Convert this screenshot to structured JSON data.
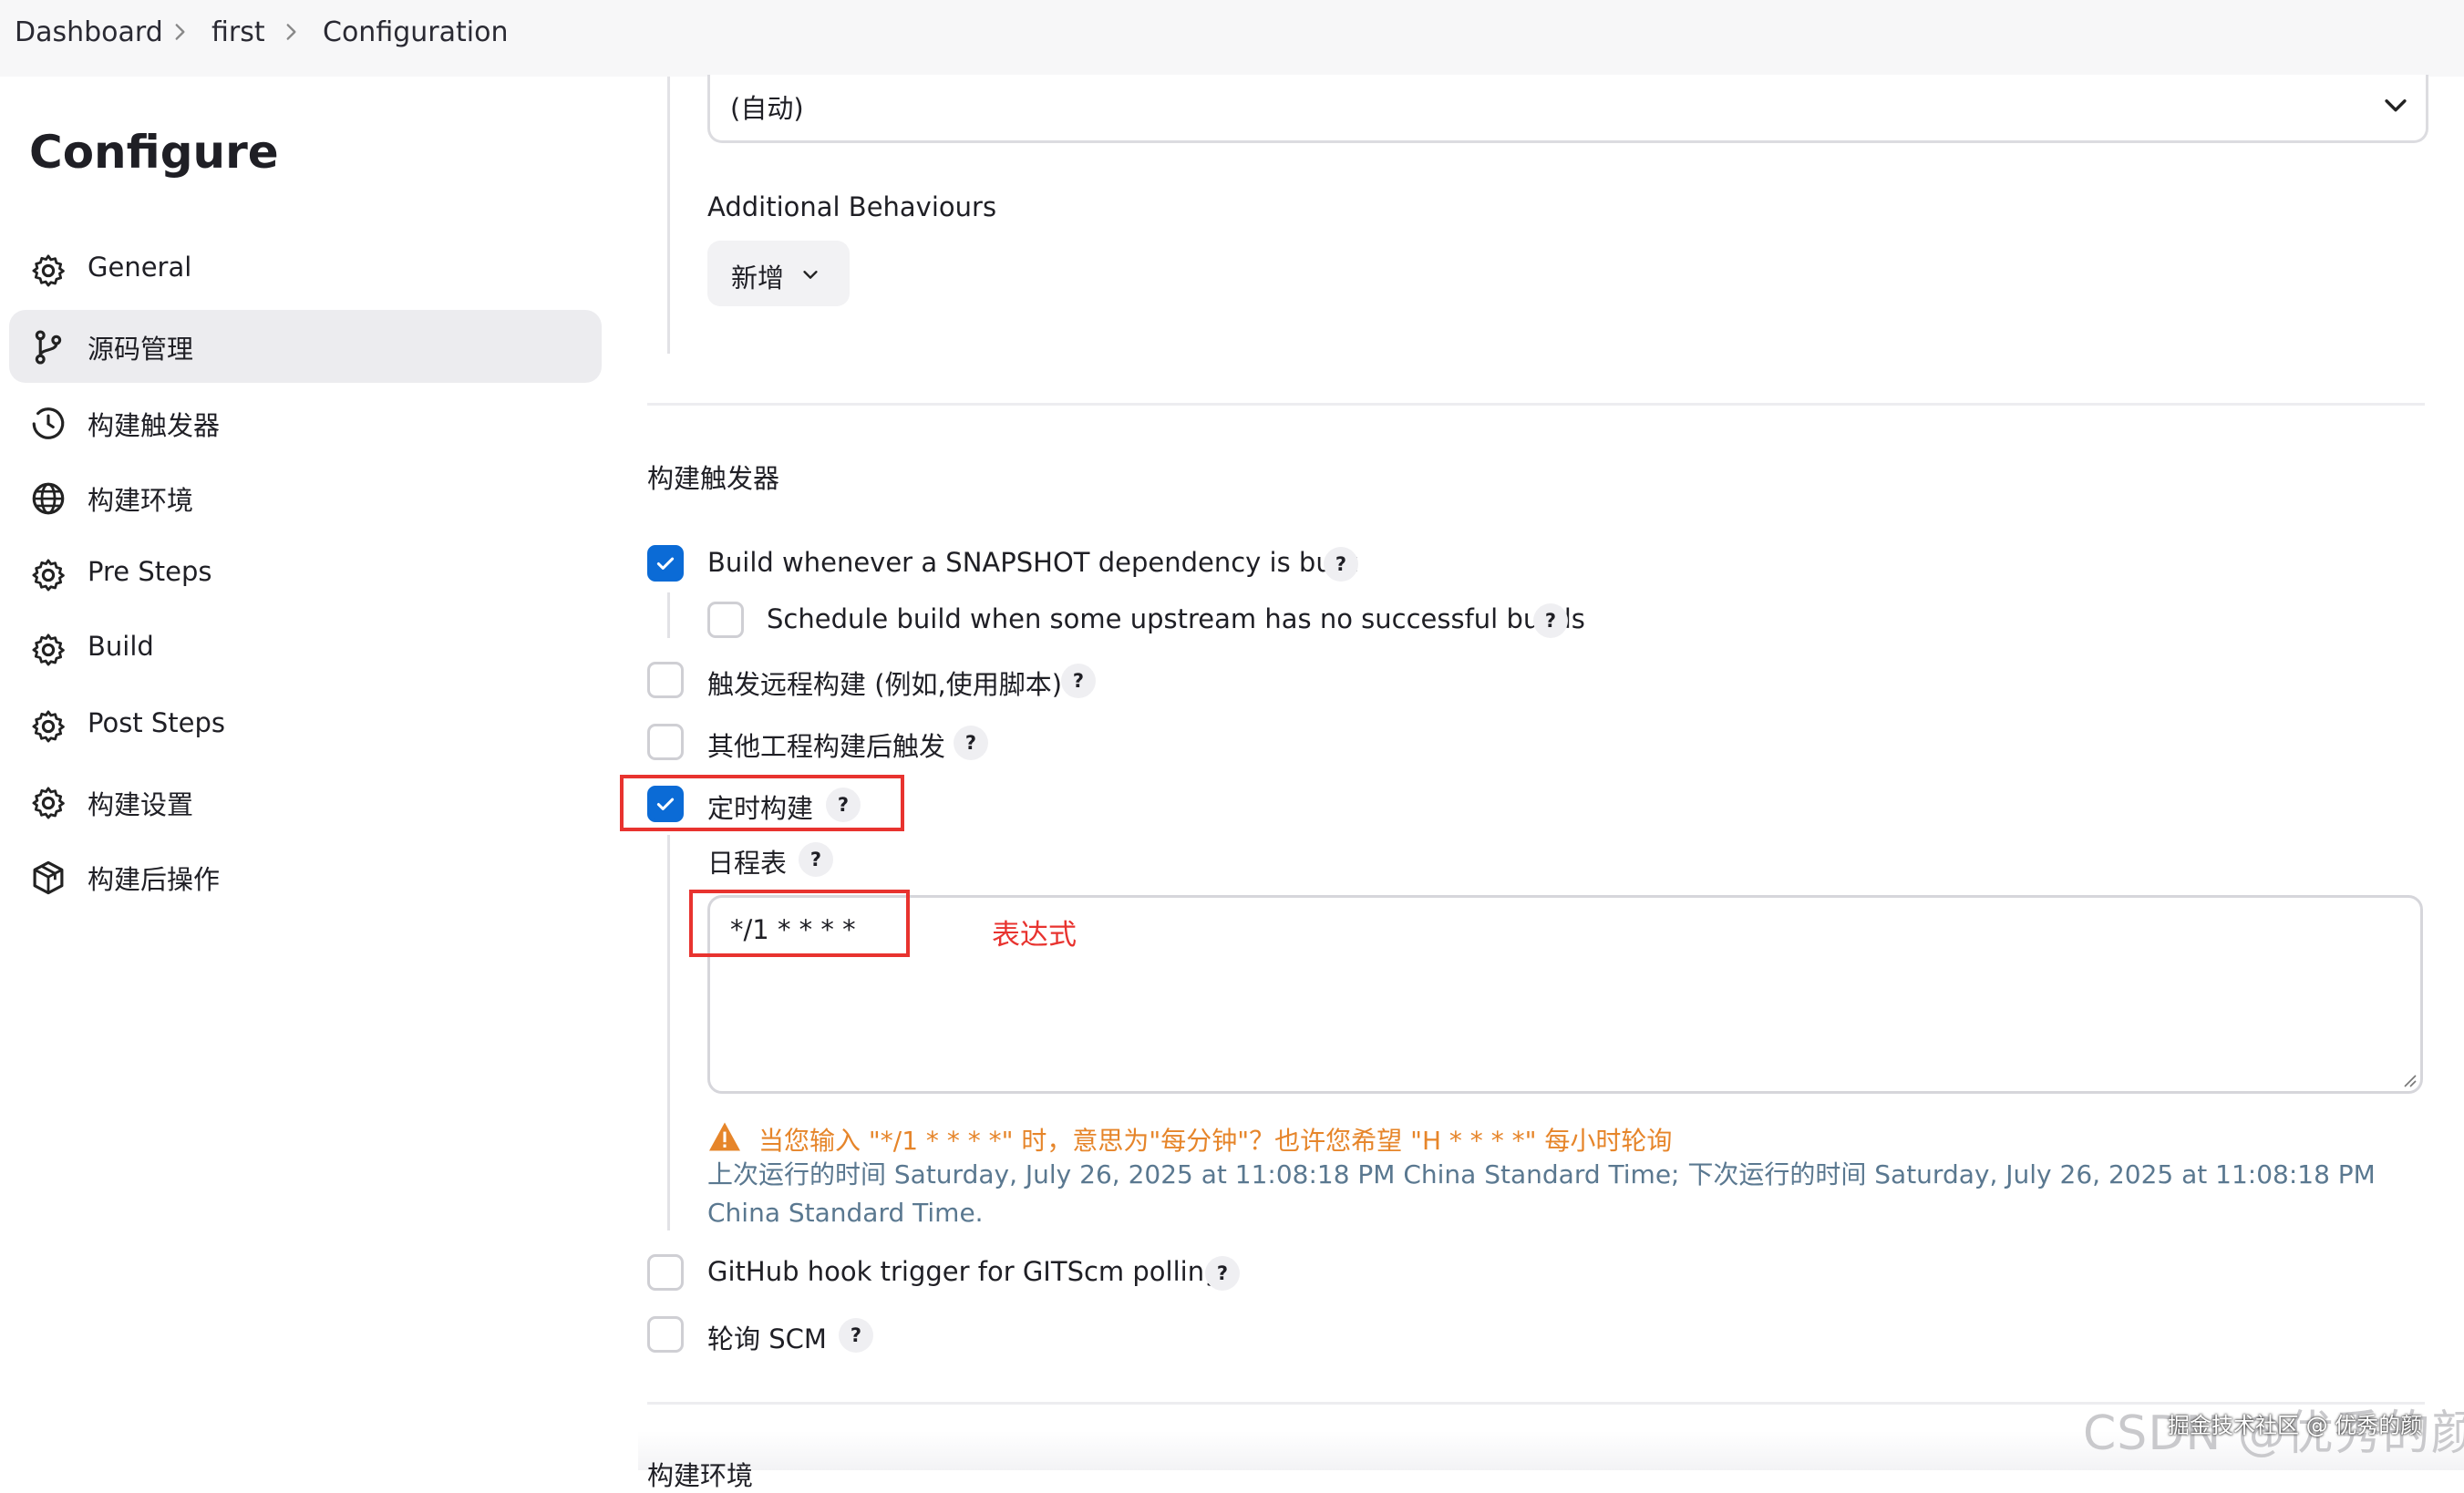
{
  "breadcrumb": {
    "items": [
      "Dashboard",
      "first",
      "Configuration"
    ]
  },
  "sidebar": {
    "title": "Configure",
    "items": [
      {
        "label": "General",
        "icon": "gear-icon"
      },
      {
        "label": "源码管理",
        "icon": "branch-icon"
      },
      {
        "label": "构建触发器",
        "icon": "clock-icon"
      },
      {
        "label": "构建环境",
        "icon": "globe-icon"
      },
      {
        "label": "Pre Steps",
        "icon": "gear-icon"
      },
      {
        "label": "Build",
        "icon": "gear-icon"
      },
      {
        "label": "Post Steps",
        "icon": "gear-icon"
      },
      {
        "label": "构建设置",
        "icon": "gear-icon"
      },
      {
        "label": "构建后操作",
        "icon": "package-icon"
      }
    ],
    "active_index": 1
  },
  "scm": {
    "browser_select_value": "(自动)",
    "additional_behaviours_label": "Additional Behaviours",
    "add_button_label": "新增"
  },
  "triggers": {
    "section_title": "构建触发器",
    "snapshot": {
      "label": "Build whenever a SNAPSHOT dependency is built",
      "checked": true
    },
    "upstream": {
      "label": "Schedule build when some upstream has no successful builds",
      "checked": false
    },
    "remote": {
      "label": "触发远程构建 (例如,使用脚本)",
      "checked": false
    },
    "after_other": {
      "label": "其他工程构建后触发",
      "checked": false
    },
    "periodic": {
      "label": "定时构建",
      "checked": true
    },
    "schedule_label": "日程表",
    "schedule_value": "*/1 * * * *",
    "annotation": "表达式",
    "warning": "当您输入 \"*/1 * * * *\" 时，意思为\"每分钟\"？也许您希望 \"H * * * *\" 每小时轮询",
    "run_info": "上次运行的时间 Saturday, July 26, 2025 at 11:08:18 PM China Standard Time; 下次运行的时间 Saturday, July 26, 2025 at 11:08:18 PM China Standard Time.",
    "github_hook": {
      "label": "GitHub hook trigger for GITScm polling",
      "checked": false
    },
    "poll_scm": {
      "label": "轮询 SCM",
      "checked": false
    }
  },
  "next_section_title": "构建环境",
  "watermark": {
    "main": "CSDN @优秀的颜",
    "overlay": "掘金技术社区 @ 优秀的颜"
  },
  "colors": {
    "accent": "#0b6bd6",
    "annotation_red": "#e8332f",
    "warning": "#e6852a",
    "info": "#5a7890",
    "active_bg": "#ececef"
  },
  "help_glyph": "?"
}
